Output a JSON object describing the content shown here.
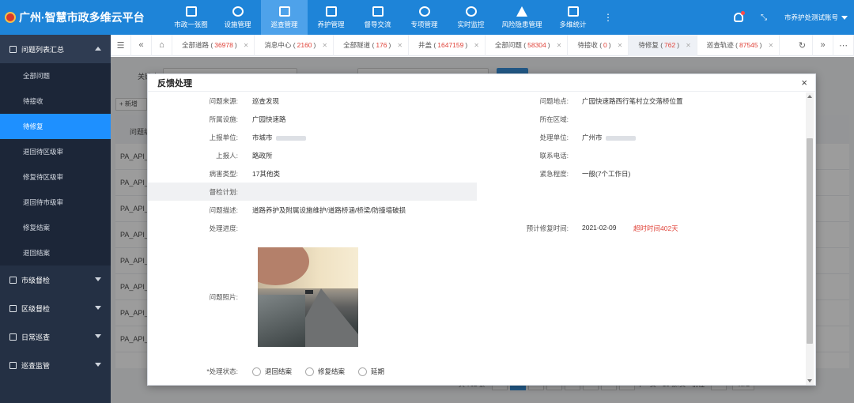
{
  "app": {
    "title": "广州·智慧市政多维云平台"
  },
  "nav": [
    {
      "label": "市政一张图",
      "icon": "map-icon"
    },
    {
      "label": "设施管理",
      "icon": "cube-icon"
    },
    {
      "label": "巡查管理",
      "icon": "inspection-icon",
      "active": true
    },
    {
      "label": "养护管理",
      "icon": "maintenance-icon"
    },
    {
      "label": "督导交流",
      "icon": "supervision-icon"
    },
    {
      "label": "专项管理",
      "icon": "special-icon"
    },
    {
      "label": "实时监控",
      "icon": "monitor-icon"
    },
    {
      "label": "风险隐患管理",
      "icon": "warning-icon"
    },
    {
      "label": "多维统计",
      "icon": "chart-icon"
    }
  ],
  "header": {
    "account": "市养护处测试账号",
    "more": "⋮",
    "fullscreen": "⤡"
  },
  "sidebar": {
    "groups": [
      {
        "label": "问题列表汇总",
        "expanded": true,
        "icon": "list-icon"
      },
      {
        "label": "市级督检",
        "icon": "city-check-icon"
      },
      {
        "label": "区级督检",
        "icon": "district-check-icon"
      },
      {
        "label": "日常巡查",
        "icon": "daily-icon"
      },
      {
        "label": "巡查监管",
        "icon": "watch-icon"
      }
    ],
    "items": [
      "全部问题",
      "待接收",
      "待修复",
      "退回待区级审",
      "修复待区级审",
      "退回待市级审",
      "修复结案",
      "退回结案"
    ]
  },
  "tabs": [
    {
      "label": "全部道路",
      "count": "36978"
    },
    {
      "label": "消息中心",
      "count": "2160"
    },
    {
      "label": "全部隧道",
      "count": "176"
    },
    {
      "label": "井盖",
      "count": "1647159"
    },
    {
      "label": "全部问题",
      "count": "58304"
    },
    {
      "label": "待接收",
      "count": "0"
    },
    {
      "label": "待修复",
      "count": "762",
      "active": true
    },
    {
      "label": "巡查轨迹",
      "count": "87545"
    }
  ],
  "background": {
    "keyword_label": "关键字",
    "add_button": "+ 新增",
    "table_header": "问题编",
    "row_prefix": "PA_API_",
    "pager": {
      "total": "共 762 条",
      "pages": [
        "1",
        "2",
        "3",
        "4",
        "5",
        "...",
        "77"
      ],
      "next": "下一页",
      "per_page": "10 条/页",
      "goto": "前往",
      "page_input": "1",
      "ok": "确定"
    }
  },
  "modal": {
    "title": "反馈处理",
    "close": "×",
    "fields": {
      "source_label": "问题来源:",
      "source": "巡查发现",
      "location_label": "问题地点:",
      "location": "广园快速路西行笔村立交落桥位置",
      "facility_label": "所属设施:",
      "facility": "广园快速路",
      "area_label": "所在区域:",
      "area": "",
      "report_unit_label": "上报单位:",
      "report_unit": "市城市",
      "handle_unit_label": "处理单位:",
      "handle_unit": "广州市",
      "reporter_label": "上报人:",
      "reporter": "路政所",
      "phone_label": "联系电话:",
      "phone": "",
      "disease_label": "病害类型:",
      "disease": "17其他类",
      "urgency_label": "紧急程度:",
      "urgency": "一般(7个工作日)",
      "plan_label": "督检计划:",
      "plan": "",
      "desc_label": "问题描述:",
      "desc": "道路养护及附属设施维护/道路桥涵/桥梁/防撞墙破损",
      "progress_label": "处理进度:",
      "progress": "",
      "eta_label": "预计修复时间:",
      "eta": "2021-02-09",
      "overdue": "超时时间402天",
      "photo_label": "问题照片:",
      "status_label": "*处理状态:",
      "status_options": [
        "退回结案",
        "修复结案",
        "延期"
      ]
    }
  }
}
